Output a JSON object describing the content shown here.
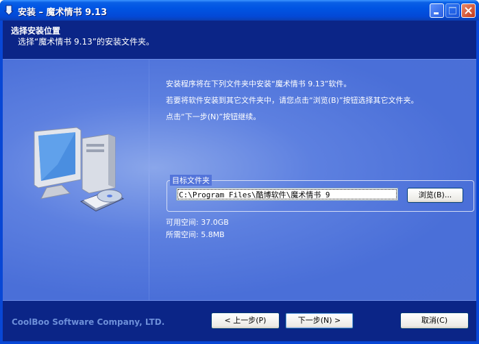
{
  "window": {
    "title": "安装 – 魔术情书 9.13"
  },
  "header": {
    "title": "选择安装位置",
    "subtitle": "选择“魔术情书 9.13”的安装文件夹。"
  },
  "body": {
    "line1": "安装程序将在下列文件夹中安装“魔术情书 9.13”软件。",
    "line2": "若要将软件安装到其它文件夹中，请您点击“浏览(B)”按钮选择其它文件夹。",
    "line3": "点击“下一步(N)”按钮继续。",
    "target_group_label": "目标文件夹",
    "target_path": "C:\\Program Files\\酷博软件\\魔术情书 9",
    "browse_label": "浏览(B)...",
    "space_available": "可用空间: 37.0GB",
    "space_required": "所需空间: 5.8MB"
  },
  "footer": {
    "brand": "CoolBoo Software Company, LTD.",
    "back_label": "< 上一步(P)",
    "next_label": "下一步(N) >",
    "cancel_label": "取消(C)"
  },
  "icons": [
    "installer-icon",
    "minimize-icon",
    "maximize-icon",
    "close-icon",
    "computer-cd-illustration"
  ],
  "colors": {
    "titlebar": "#0054e3",
    "header": "#0b2587",
    "content": "#5d80e0",
    "brand": "#6d8fd9"
  }
}
